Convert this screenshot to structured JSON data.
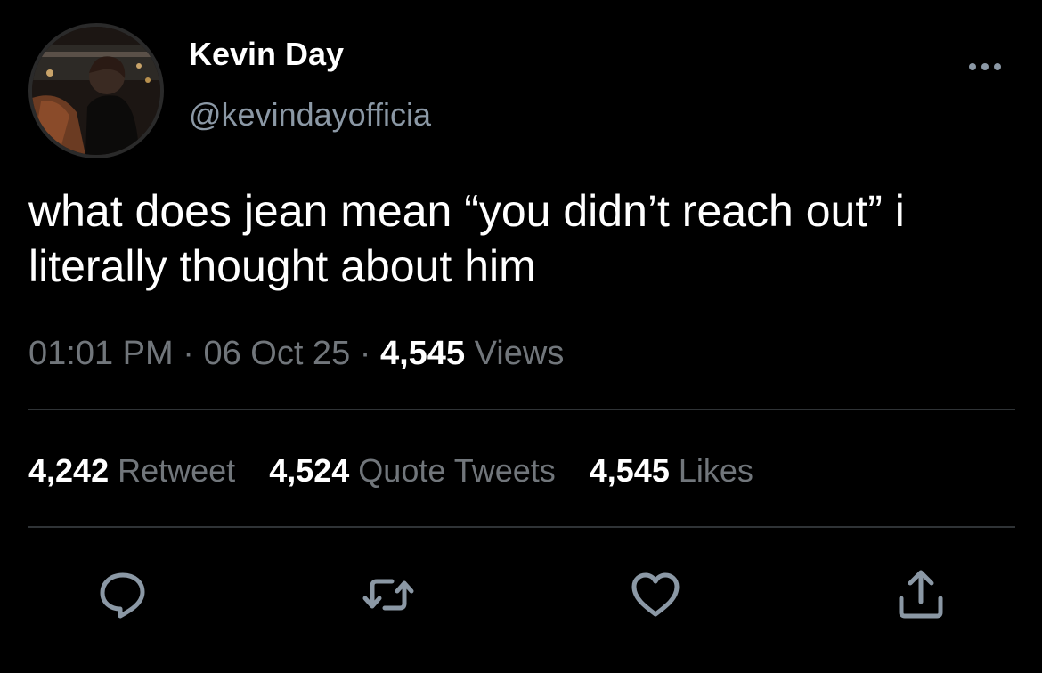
{
  "author": {
    "display_name": "Kevin Day",
    "handle": "@kevindayofficia"
  },
  "tweet": {
    "text": "what does jean mean “you didn’t reach out” i literally thought about him",
    "time": "01:01 PM",
    "date": "06 Oct 25",
    "separator": "·",
    "views_count": "4,545",
    "views_label": "Views"
  },
  "stats": {
    "retweets": {
      "count": "4,242",
      "label": "Retweet"
    },
    "quotes": {
      "count": "4,524",
      "label": "Quote Tweets"
    },
    "likes": {
      "count": "4,545",
      "label": "Likes"
    }
  },
  "icons": {
    "more": "more-icon",
    "reply": "reply-icon",
    "retweet": "retweet-icon",
    "like": "heart-icon",
    "share": "share-icon"
  },
  "colors": {
    "background": "#000000",
    "primary_text": "#ffffff",
    "secondary_text": "#71767b",
    "icon": "#8b98a5",
    "divider": "#2f3336"
  }
}
